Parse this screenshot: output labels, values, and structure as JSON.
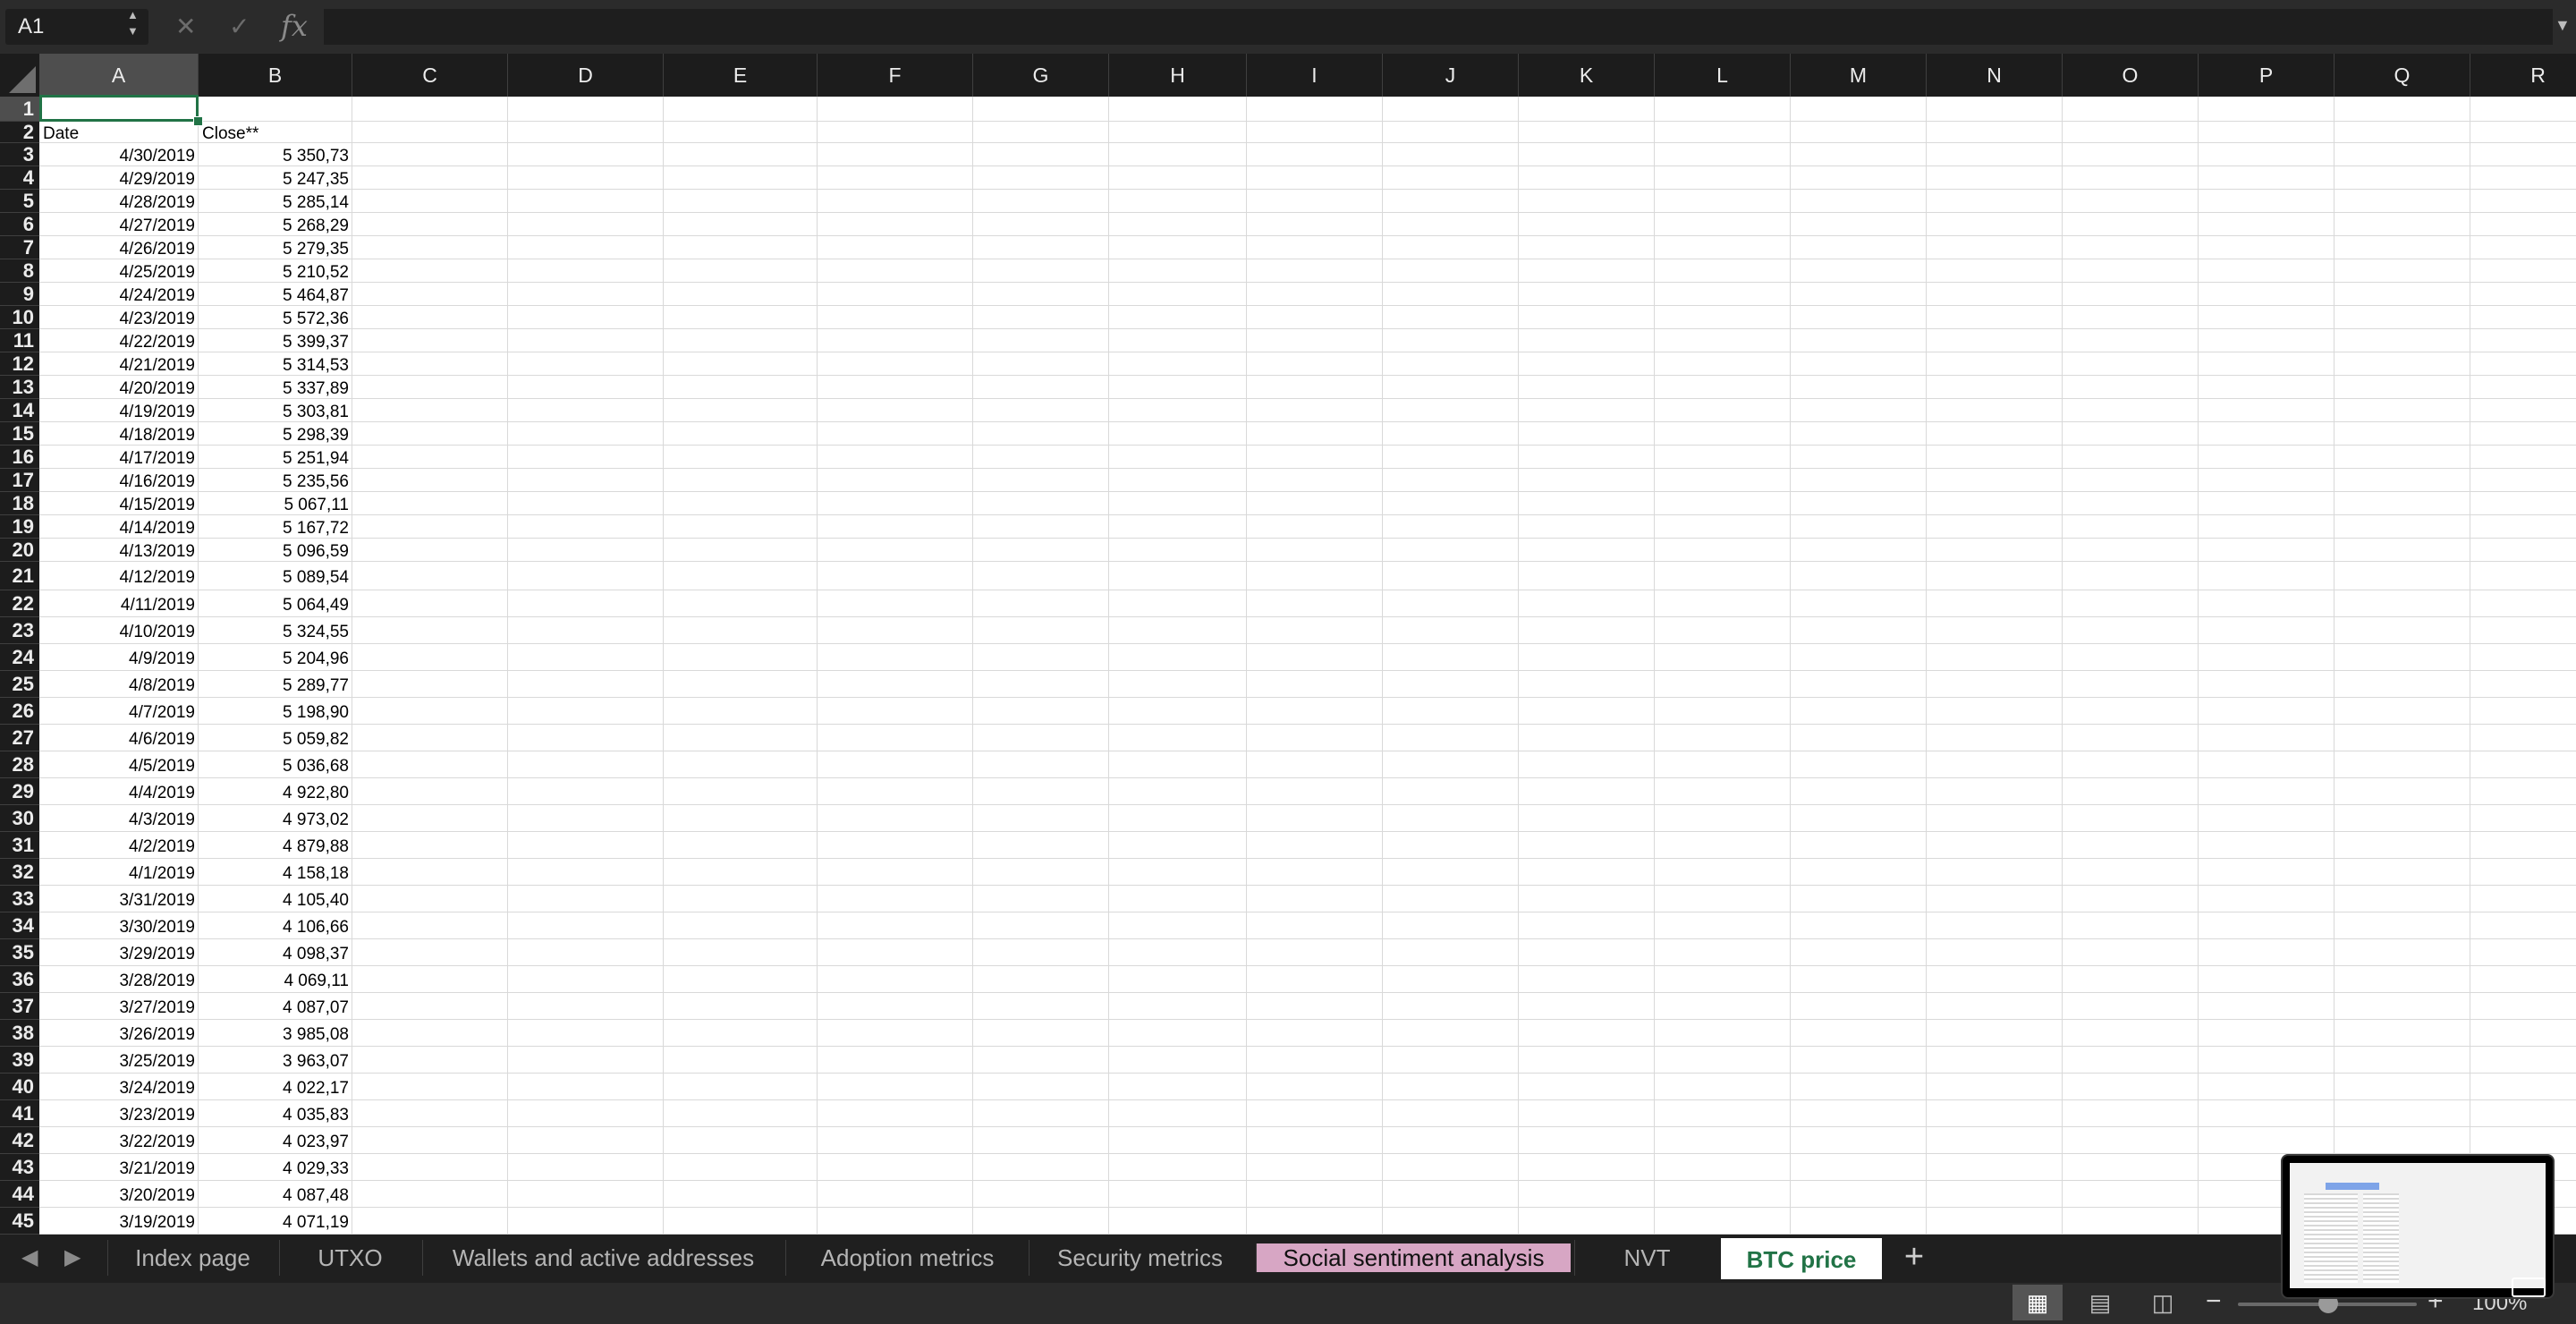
{
  "formula_bar": {
    "name_box": "A1",
    "cancel_icon": "✕",
    "enter_icon": "✓",
    "fx_label": "fx",
    "formula_value": ""
  },
  "columns": [
    "A",
    "B",
    "C",
    "D",
    "E",
    "F",
    "G",
    "H",
    "I",
    "J",
    "K",
    "L",
    "M",
    "N",
    "O",
    "P",
    "Q",
    "R"
  ],
  "rows": [
    {
      "n": "1",
      "a": "",
      "b": ""
    },
    {
      "n": "2",
      "a": "Date",
      "b": "Close**"
    },
    {
      "n": "3",
      "a": "4/30/2019",
      "b": "5 350,73"
    },
    {
      "n": "4",
      "a": "4/29/2019",
      "b": "5 247,35"
    },
    {
      "n": "5",
      "a": "4/28/2019",
      "b": "5 285,14"
    },
    {
      "n": "6",
      "a": "4/27/2019",
      "b": "5 268,29"
    },
    {
      "n": "7",
      "a": "4/26/2019",
      "b": "5 279,35"
    },
    {
      "n": "8",
      "a": "4/25/2019",
      "b": "5 210,52"
    },
    {
      "n": "9",
      "a": "4/24/2019",
      "b": "5 464,87"
    },
    {
      "n": "10",
      "a": "4/23/2019",
      "b": "5 572,36"
    },
    {
      "n": "11",
      "a": "4/22/2019",
      "b": "5 399,37"
    },
    {
      "n": "12",
      "a": "4/21/2019",
      "b": "5 314,53"
    },
    {
      "n": "13",
      "a": "4/20/2019",
      "b": "5 337,89"
    },
    {
      "n": "14",
      "a": "4/19/2019",
      "b": "5 303,81"
    },
    {
      "n": "15",
      "a": "4/18/2019",
      "b": "5 298,39"
    },
    {
      "n": "16",
      "a": "4/17/2019",
      "b": "5 251,94"
    },
    {
      "n": "17",
      "a": "4/16/2019",
      "b": "5 235,56"
    },
    {
      "n": "18",
      "a": "4/15/2019",
      "b": "5 067,11"
    },
    {
      "n": "19",
      "a": "4/14/2019",
      "b": "5 167,72"
    },
    {
      "n": "20",
      "a": "4/13/2019",
      "b": "5 096,59"
    },
    {
      "n": "21",
      "a": "4/12/2019",
      "b": "5 089,54"
    },
    {
      "n": "22",
      "a": "4/11/2019",
      "b": "5 064,49"
    },
    {
      "n": "23",
      "a": "4/10/2019",
      "b": "5 324,55"
    },
    {
      "n": "24",
      "a": "4/9/2019",
      "b": "5 204,96"
    },
    {
      "n": "25",
      "a": "4/8/2019",
      "b": "5 289,77"
    },
    {
      "n": "26",
      "a": "4/7/2019",
      "b": "5 198,90"
    },
    {
      "n": "27",
      "a": "4/6/2019",
      "b": "5 059,82"
    },
    {
      "n": "28",
      "a": "4/5/2019",
      "b": "5 036,68"
    },
    {
      "n": "29",
      "a": "4/4/2019",
      "b": "4 922,80"
    },
    {
      "n": "30",
      "a": "4/3/2019",
      "b": "4 973,02"
    },
    {
      "n": "31",
      "a": "4/2/2019",
      "b": "4 879,88"
    },
    {
      "n": "32",
      "a": "4/1/2019",
      "b": "4 158,18"
    },
    {
      "n": "33",
      "a": "3/31/2019",
      "b": "4 105,40"
    },
    {
      "n": "34",
      "a": "3/30/2019",
      "b": "4 106,66"
    },
    {
      "n": "35",
      "a": "3/29/2019",
      "b": "4 098,37"
    },
    {
      "n": "36",
      "a": "3/28/2019",
      "b": "4 069,11"
    },
    {
      "n": "37",
      "a": "3/27/2019",
      "b": "4 087,07"
    },
    {
      "n": "38",
      "a": "3/26/2019",
      "b": "3 985,08"
    },
    {
      "n": "39",
      "a": "3/25/2019",
      "b": "3 963,07"
    },
    {
      "n": "40",
      "a": "3/24/2019",
      "b": "4 022,17"
    },
    {
      "n": "41",
      "a": "3/23/2019",
      "b": "4 035,83"
    },
    {
      "n": "42",
      "a": "3/22/2019",
      "b": "4 023,97"
    },
    {
      "n": "43",
      "a": "3/21/2019",
      "b": "4 029,33"
    },
    {
      "n": "44",
      "a": "3/20/2019",
      "b": "4 087,48"
    },
    {
      "n": "45",
      "a": "3/19/2019",
      "b": "4 071,19"
    }
  ],
  "tabs": {
    "nav_left_icon": "◀",
    "nav_right_icon": "▶",
    "items": [
      "Index page",
      "UTXO",
      "Wallets and active addresses",
      "Adoption metrics",
      "Security metrics",
      "Social sentiment analysis",
      "NVT",
      "BTC price"
    ],
    "active": "BTC price",
    "add_icon": "+"
  },
  "status": {
    "zoom_minus": "−",
    "zoom_plus": "+",
    "zoom_level": "100%",
    "zoom_fraction": 0.5
  },
  "colors": {
    "accent": "#217346",
    "highlight_tab": "#d7a6c4"
  }
}
